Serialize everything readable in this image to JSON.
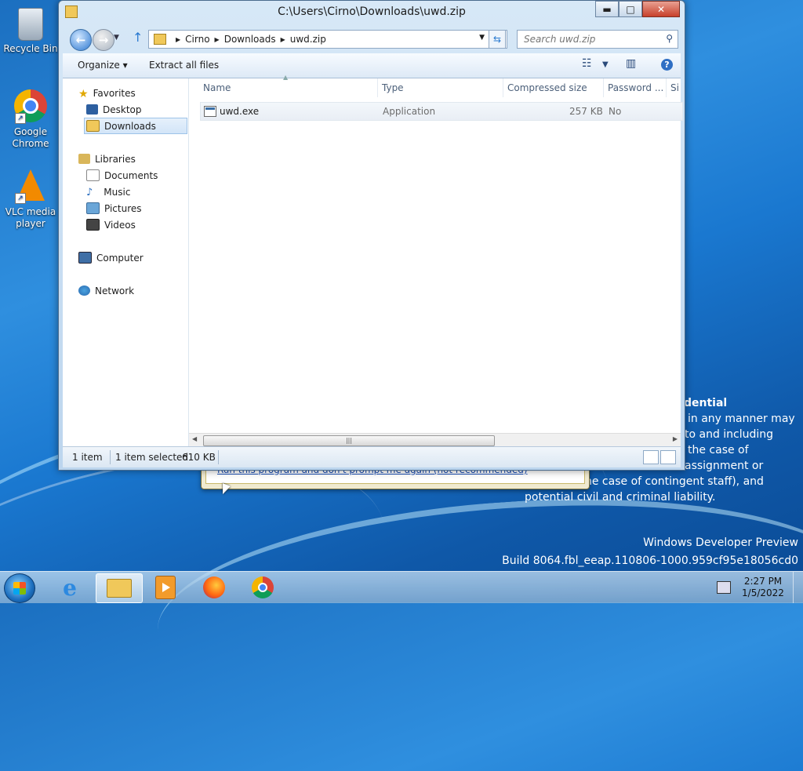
{
  "desktop": {
    "icons": [
      {
        "label": "Recycle Bin"
      },
      {
        "label": "Google Chrome"
      },
      {
        "label": "VLC media player"
      }
    ],
    "background_text": {
      "heading_fragment": "dential",
      "lines": [
        "in any manner may",
        "to and including",
        "the case of",
        "assignment or",
        "he case of contingent staff), and",
        "potential civil and criminal liability."
      ]
    },
    "watermark": {
      "line1": "Windows Developer Preview",
      "line2": "Build 8064.fbl_eeap.110806-1000.959cf95e18056cd0"
    }
  },
  "dialog_behind": {
    "link_text": "Run this program and don't prompt me again (not recommended)"
  },
  "window": {
    "title": "C:\\Users\\Cirno\\Downloads\\uwd.zip",
    "caption": {
      "minimize": "▬",
      "maximize": "□",
      "close": "✕"
    },
    "breadcrumb": [
      "Cirno",
      "Downloads",
      "uwd.zip"
    ],
    "search_placeholder": "Search uwd.zip",
    "toolbar": {
      "organize": "Organize ▾",
      "extract": "Extract all files"
    },
    "nav": {
      "favorites": "Favorites",
      "desktop": "Desktop",
      "downloads": "Downloads",
      "libraries": "Libraries",
      "documents": "Documents",
      "music": "Music",
      "pictures": "Pictures",
      "videos": "Videos",
      "computer": "Computer",
      "network": "Network"
    },
    "columns": {
      "name": "Name",
      "type": "Type",
      "compressed_size": "Compressed size",
      "password": "Password ...",
      "size_partial": "Si"
    },
    "files": [
      {
        "name": "uwd.exe",
        "type": "Application",
        "compressed_size": "257 KB",
        "password": "No"
      }
    ],
    "status": {
      "count": "1 item",
      "selected": "1 item selected",
      "size": "610 KB"
    }
  },
  "taskbar": {
    "clock_time": "2:27 PM",
    "clock_date": "1/5/2022"
  }
}
